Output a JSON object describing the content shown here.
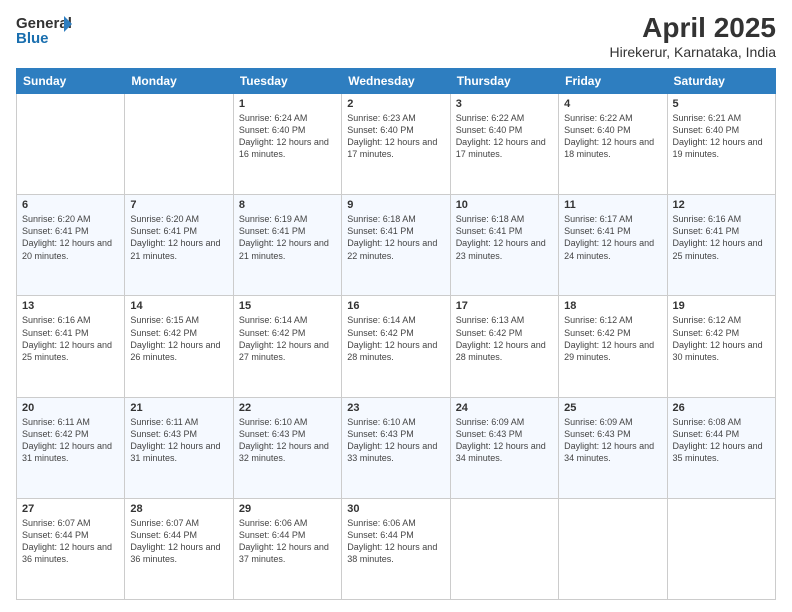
{
  "logo": {
    "line1": "General",
    "line2": "Blue"
  },
  "header": {
    "title": "April 2025",
    "location": "Hirekerur, Karnataka, India"
  },
  "days_of_week": [
    "Sunday",
    "Monday",
    "Tuesday",
    "Wednesday",
    "Thursday",
    "Friday",
    "Saturday"
  ],
  "weeks": [
    [
      {
        "day": "",
        "info": ""
      },
      {
        "day": "",
        "info": ""
      },
      {
        "day": "1",
        "info": "Sunrise: 6:24 AM\nSunset: 6:40 PM\nDaylight: 12 hours and 16 minutes."
      },
      {
        "day": "2",
        "info": "Sunrise: 6:23 AM\nSunset: 6:40 PM\nDaylight: 12 hours and 17 minutes."
      },
      {
        "day": "3",
        "info": "Sunrise: 6:22 AM\nSunset: 6:40 PM\nDaylight: 12 hours and 17 minutes."
      },
      {
        "day": "4",
        "info": "Sunrise: 6:22 AM\nSunset: 6:40 PM\nDaylight: 12 hours and 18 minutes."
      },
      {
        "day": "5",
        "info": "Sunrise: 6:21 AM\nSunset: 6:40 PM\nDaylight: 12 hours and 19 minutes."
      }
    ],
    [
      {
        "day": "6",
        "info": "Sunrise: 6:20 AM\nSunset: 6:41 PM\nDaylight: 12 hours and 20 minutes."
      },
      {
        "day": "7",
        "info": "Sunrise: 6:20 AM\nSunset: 6:41 PM\nDaylight: 12 hours and 21 minutes."
      },
      {
        "day": "8",
        "info": "Sunrise: 6:19 AM\nSunset: 6:41 PM\nDaylight: 12 hours and 21 minutes."
      },
      {
        "day": "9",
        "info": "Sunrise: 6:18 AM\nSunset: 6:41 PM\nDaylight: 12 hours and 22 minutes."
      },
      {
        "day": "10",
        "info": "Sunrise: 6:18 AM\nSunset: 6:41 PM\nDaylight: 12 hours and 23 minutes."
      },
      {
        "day": "11",
        "info": "Sunrise: 6:17 AM\nSunset: 6:41 PM\nDaylight: 12 hours and 24 minutes."
      },
      {
        "day": "12",
        "info": "Sunrise: 6:16 AM\nSunset: 6:41 PM\nDaylight: 12 hours and 25 minutes."
      }
    ],
    [
      {
        "day": "13",
        "info": "Sunrise: 6:16 AM\nSunset: 6:41 PM\nDaylight: 12 hours and 25 minutes."
      },
      {
        "day": "14",
        "info": "Sunrise: 6:15 AM\nSunset: 6:42 PM\nDaylight: 12 hours and 26 minutes."
      },
      {
        "day": "15",
        "info": "Sunrise: 6:14 AM\nSunset: 6:42 PM\nDaylight: 12 hours and 27 minutes."
      },
      {
        "day": "16",
        "info": "Sunrise: 6:14 AM\nSunset: 6:42 PM\nDaylight: 12 hours and 28 minutes."
      },
      {
        "day": "17",
        "info": "Sunrise: 6:13 AM\nSunset: 6:42 PM\nDaylight: 12 hours and 28 minutes."
      },
      {
        "day": "18",
        "info": "Sunrise: 6:12 AM\nSunset: 6:42 PM\nDaylight: 12 hours and 29 minutes."
      },
      {
        "day": "19",
        "info": "Sunrise: 6:12 AM\nSunset: 6:42 PM\nDaylight: 12 hours and 30 minutes."
      }
    ],
    [
      {
        "day": "20",
        "info": "Sunrise: 6:11 AM\nSunset: 6:42 PM\nDaylight: 12 hours and 31 minutes."
      },
      {
        "day": "21",
        "info": "Sunrise: 6:11 AM\nSunset: 6:43 PM\nDaylight: 12 hours and 31 minutes."
      },
      {
        "day": "22",
        "info": "Sunrise: 6:10 AM\nSunset: 6:43 PM\nDaylight: 12 hours and 32 minutes."
      },
      {
        "day": "23",
        "info": "Sunrise: 6:10 AM\nSunset: 6:43 PM\nDaylight: 12 hours and 33 minutes."
      },
      {
        "day": "24",
        "info": "Sunrise: 6:09 AM\nSunset: 6:43 PM\nDaylight: 12 hours and 34 minutes."
      },
      {
        "day": "25",
        "info": "Sunrise: 6:09 AM\nSunset: 6:43 PM\nDaylight: 12 hours and 34 minutes."
      },
      {
        "day": "26",
        "info": "Sunrise: 6:08 AM\nSunset: 6:44 PM\nDaylight: 12 hours and 35 minutes."
      }
    ],
    [
      {
        "day": "27",
        "info": "Sunrise: 6:07 AM\nSunset: 6:44 PM\nDaylight: 12 hours and 36 minutes."
      },
      {
        "day": "28",
        "info": "Sunrise: 6:07 AM\nSunset: 6:44 PM\nDaylight: 12 hours and 36 minutes."
      },
      {
        "day": "29",
        "info": "Sunrise: 6:06 AM\nSunset: 6:44 PM\nDaylight: 12 hours and 37 minutes."
      },
      {
        "day": "30",
        "info": "Sunrise: 6:06 AM\nSunset: 6:44 PM\nDaylight: 12 hours and 38 minutes."
      },
      {
        "day": "",
        "info": ""
      },
      {
        "day": "",
        "info": ""
      },
      {
        "day": "",
        "info": ""
      }
    ]
  ]
}
